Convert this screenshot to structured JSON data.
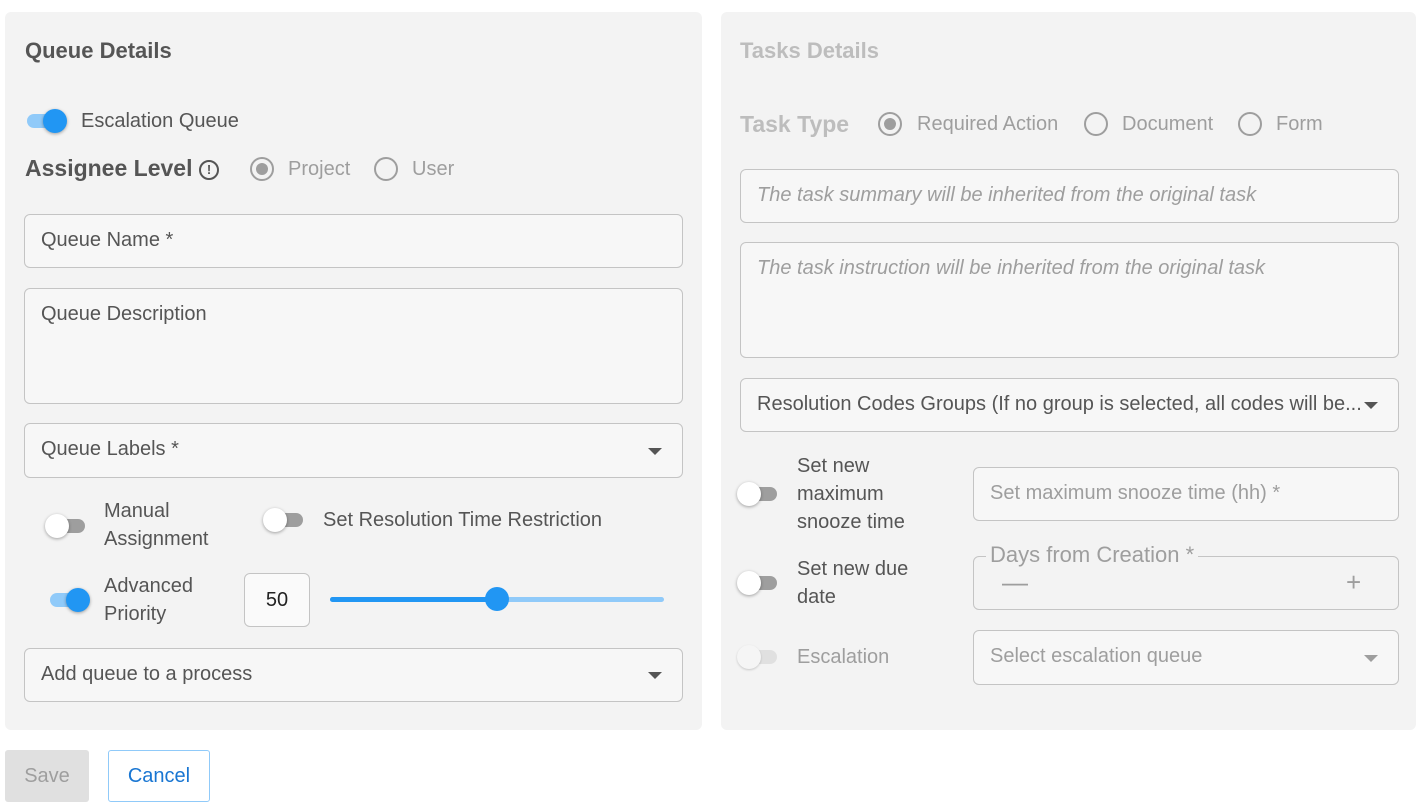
{
  "queue_details": {
    "title": "Queue Details",
    "escalation_queue_label": "Escalation Queue",
    "escalation_queue_on": true,
    "assignee_level_label": "Assignee Level",
    "assignee_options": [
      "Project",
      "User"
    ],
    "assignee_selected": "Project",
    "queue_name_placeholder": "Queue Name *",
    "queue_description_placeholder": "Queue Description",
    "queue_labels_placeholder": "Queue Labels *",
    "manual_assignment_label_line1": "Manual",
    "manual_assignment_label_line2": "Assignment",
    "manual_assignment_on": false,
    "resolution_time_label": "Set Resolution Time Restriction",
    "resolution_time_on": false,
    "advanced_priority_label_line1": "Advanced",
    "advanced_priority_label_line2": "Priority",
    "advanced_priority_on": true,
    "priority_value": "50",
    "priority_fraction": 0.5,
    "process_placeholder": "Add queue to a process"
  },
  "task_details": {
    "title": "Tasks Details",
    "task_type_label": "Task Type",
    "task_type_options": [
      "Required Action",
      "Document",
      "Form"
    ],
    "task_type_selected": "Required Action",
    "summary_placeholder": "The task summary will be inherited from the original task",
    "instruction_placeholder": "The task instruction will be inherited from the original task",
    "resolution_codes_placeholder": "Resolution Codes Groups (If no group is selected, all codes will be...",
    "snooze_label_line1": "Set new",
    "snooze_label_line2": "maximum",
    "snooze_label_line3": "snooze time",
    "snooze_on": false,
    "snooze_placeholder": "Set maximum snooze time (hh) *",
    "due_date_label_line1": "Set new due",
    "due_date_label_line2": "date",
    "due_date_on": false,
    "days_from_creation_label": "Days from Creation *",
    "minus_symbol": "—",
    "plus_symbol": "+",
    "escalation_label": "Escalation",
    "escalation_on": false,
    "escalation_queue_placeholder": "Select escalation queue"
  },
  "actions": {
    "save_label": "Save",
    "cancel_label": "Cancel"
  },
  "colors": {
    "accent": "#2196f3",
    "accent_light": "#90caf9",
    "panel_bg": "#f3f3f3"
  }
}
